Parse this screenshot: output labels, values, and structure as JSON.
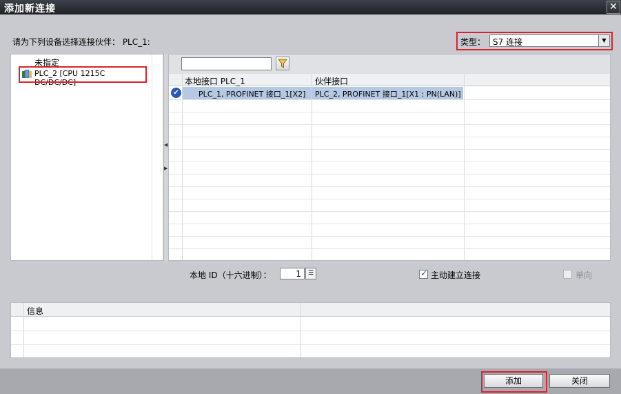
{
  "window": {
    "title": "添加新连接",
    "close_symbol": "✕"
  },
  "prompt": "请为下列设备选择连接伙伴： PLC_1:",
  "type_selector": {
    "label": "类型：",
    "value": "S7 连接"
  },
  "tree": {
    "unassigned_label": "未指定",
    "device_label": "PLC_2 [CPU 1215C DC/DC/DC]"
  },
  "filter": {
    "value": ""
  },
  "table": {
    "headers": {
      "local": "本地接口 PLC_1",
      "partner": "伙伴接口"
    },
    "rows": [
      {
        "local": "PLC_1, PROFINET 接口_1[X2]",
        "partner": "PLC_2, PROFINET 接口_1[X1 : PN(LAN)]",
        "selected": true
      }
    ]
  },
  "local_id": {
    "label": "本地 ID（十六进制）：",
    "value": "1"
  },
  "active_connection": {
    "label": "主动建立连接",
    "checked": true
  },
  "one_way": {
    "label": "单向",
    "checked": false,
    "enabled": false
  },
  "info": {
    "header": "信息"
  },
  "buttons": {
    "add": "添加",
    "close": "关闭"
  },
  "colors": {
    "highlight": "#d8232a",
    "selection": "#b5c9e3",
    "title_bg": "#1e2226"
  }
}
